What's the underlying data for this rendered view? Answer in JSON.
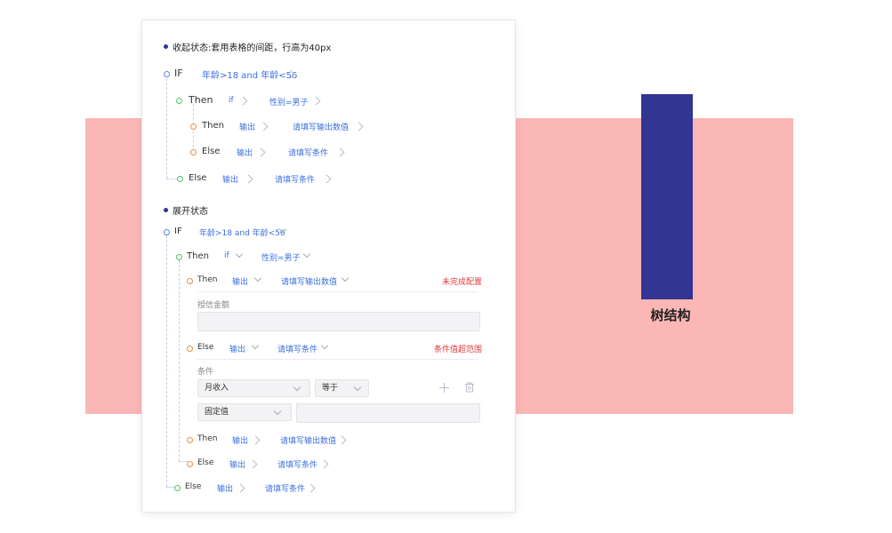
{
  "side": {
    "label": "树结构",
    "colors": {
      "band": "#fbb7b5",
      "bar": "#323592"
    }
  },
  "collapsed": {
    "title": "收起状态:套用表格的间距，行高为40px",
    "if_kw": "IF",
    "if_cond": "年龄>18 and 年龄<56",
    "then_kw": "Then",
    "then_if": "if",
    "then_cond": "性别=男子",
    "inner_then_kw": "Then",
    "inner_then_out": "输出",
    "inner_then_val": "请填写输出数值",
    "inner_else_kw": "Else",
    "inner_else_out": "输出",
    "inner_else_val": "请填写条件",
    "else_kw": "Else",
    "else_out": "输出",
    "else_val": "请填写条件"
  },
  "expanded": {
    "title": "展开状态",
    "if_kw": "IF",
    "if_cond": "年龄>18 and 年龄<56",
    "then_kw": "Then",
    "then_if": "if",
    "then_cond": "性别=男子",
    "then1": {
      "kw": "Then",
      "out": "输出",
      "val": "请填写输出数值",
      "error": "未完成配置",
      "field_label": "授信金额",
      "field_value": ""
    },
    "else1": {
      "kw": "Else",
      "out": "输出",
      "val": "请填写条件",
      "error": "条件值超范围",
      "cond_label": "条件",
      "select1": "月收入",
      "select2": "等于",
      "select3": "固定值",
      "value": ""
    },
    "then2": {
      "kw": "Then",
      "out": "输出",
      "val": "请填写输出数值"
    },
    "else2": {
      "kw": "Else",
      "out": "输出",
      "val": "请填写条件"
    },
    "else3": {
      "kw": "Else",
      "out": "输出",
      "val": "请填写条件"
    }
  },
  "colors": {
    "link": "#3a6fe0",
    "error": "#e03b3b",
    "node_blue": "#5b86e5",
    "node_green": "#4cc26b",
    "node_orange": "#f08c46"
  },
  "icons": [
    "chevron-right-icon",
    "chevron-down-icon",
    "plus-icon",
    "trash-icon"
  ]
}
